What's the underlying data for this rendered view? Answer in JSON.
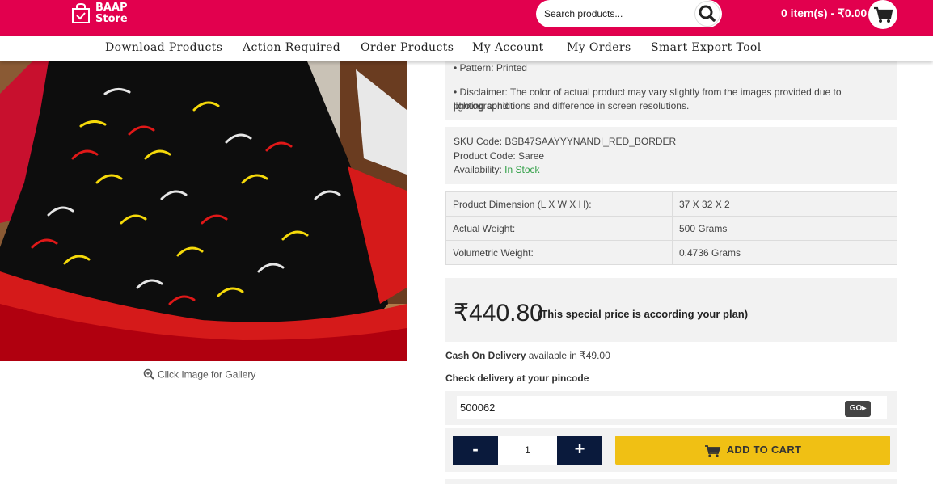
{
  "brand": {
    "line1": "BAAP",
    "line2": "Store",
    "icon": "shopping-bag-icon"
  },
  "search": {
    "placeholder": "Search products...",
    "icon": "search-icon"
  },
  "cart": {
    "summary": "0 item(s) - ₹0.00",
    "icon": "cart-icon"
  },
  "nav": {
    "items": [
      {
        "label": "Download Products"
      },
      {
        "label": "Action Required"
      },
      {
        "label": "Order Products"
      },
      {
        "label": "My Account"
      },
      {
        "label": "My Orders"
      },
      {
        "label": "Smart Export Tool"
      }
    ]
  },
  "gallery": {
    "hint": "Click Image for Gallery",
    "icon": "zoom-in-icon"
  },
  "description": {
    "pattern": "• Pattern: Printed",
    "disclaimer_line1": "• Disclaimer: The color of actual product may vary slightly from the images provided due to photographic",
    "disclaimer_line2": "lighting conditions and difference in screen resolutions."
  },
  "sku": {
    "sku_code": "SKU Code: BSB47SAAYYYNANDI_RED_BORDER",
    "product_code": "Product Code: Saree",
    "availability_label": "Availability: ",
    "availability_value": "In Stock"
  },
  "dimensions": {
    "rows": [
      {
        "key": "Product Dimension (L X W X H):",
        "value": "37 X 32 X 2"
      },
      {
        "key": "Actual Weight:",
        "value": "500 Grams"
      },
      {
        "key": "Volumetric Weight:",
        "value": "0.4736 Grams"
      }
    ]
  },
  "price": {
    "amount": "₹440.80",
    "note": "(This special price is according your plan)"
  },
  "cod": {
    "label": "Cash On Delivery",
    "text": " available in ₹49.00"
  },
  "delivery": {
    "check_label": "Check delivery at your pincode",
    "pincode": "500062",
    "go_label": "GO"
  },
  "quantity": {
    "minus": "-",
    "value": "1",
    "plus": "+"
  },
  "add_to_cart": {
    "label": "ADD TO CART",
    "icon": "cart-icon"
  },
  "colors": {
    "brand": "#e2004e",
    "button_dark": "#0a1a3c",
    "cart_button": "#f0c014",
    "in_stock": "#2e9e44"
  }
}
